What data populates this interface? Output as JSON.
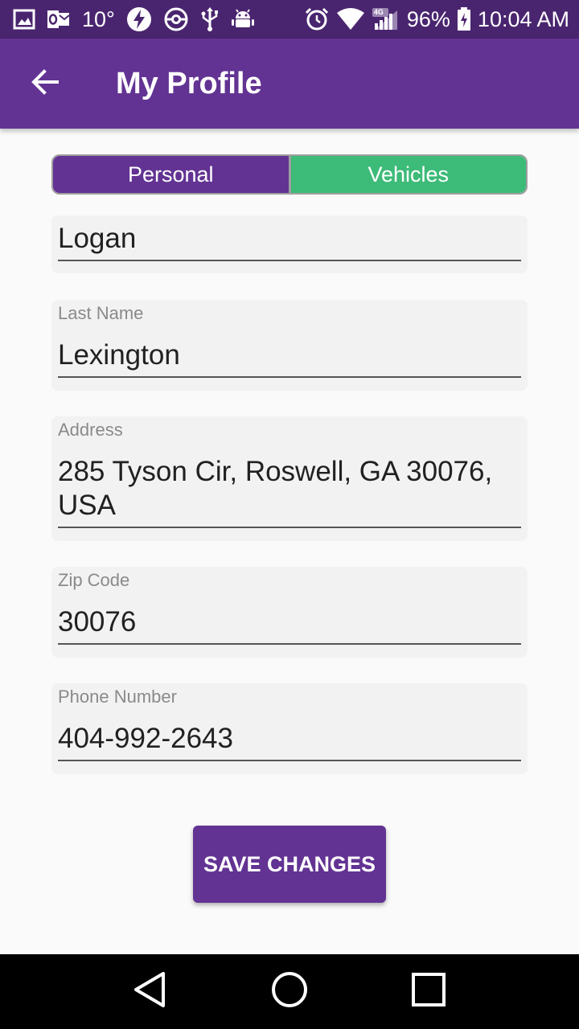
{
  "status_bar": {
    "temperature": "10°",
    "network_type": "4G",
    "battery": "96%",
    "time": "10:04 AM",
    "icons": [
      "gallery-icon",
      "outlook-icon",
      "flash-icon",
      "pokeball-icon",
      "usb-icon",
      "android-icon",
      "alarm-icon",
      "wifi-icon",
      "signal-icon",
      "battery-charging-icon"
    ]
  },
  "app_bar": {
    "title": "My Profile",
    "back_icon": "arrow-back-icon"
  },
  "tabs": {
    "personal": "Personal",
    "vehicles": "Vehicles"
  },
  "form": {
    "first_name": {
      "label": "",
      "value": "Logan"
    },
    "last_name": {
      "label": "Last Name",
      "value": "Lexington"
    },
    "address": {
      "label": "Address",
      "value_line1": "285 Tyson Cir, Roswell, GA 30076,",
      "value_line2": "USA"
    },
    "zip_code": {
      "label": "Zip Code",
      "value": "30076"
    },
    "phone": {
      "label": "Phone Number",
      "value": "404-992-2643"
    }
  },
  "save_button": {
    "label": "SAVE CHANGES"
  },
  "colors": {
    "primary": "#623393",
    "status_bar": "#4a256f",
    "vehicles_tab": "#3dbb78",
    "field_bg": "#f2f2f2"
  },
  "nav_bar": {
    "icons": [
      "back-triangle-icon",
      "home-circle-icon",
      "recents-square-icon"
    ]
  }
}
